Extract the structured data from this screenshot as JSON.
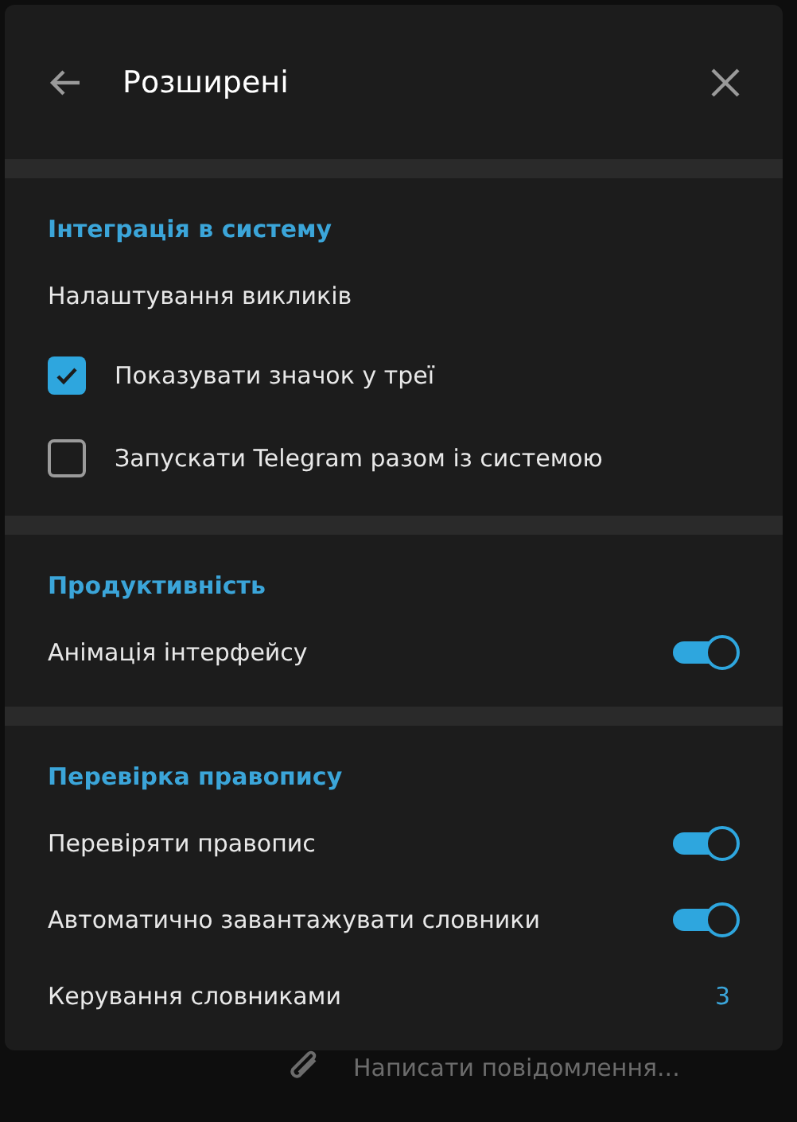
{
  "dialog": {
    "title": "Розширені",
    "sections": [
      {
        "title": "Інтеграція в систему",
        "items": [
          {
            "kind": "link",
            "label": "Налаштування викликів"
          },
          {
            "kind": "checkbox",
            "label": "Показувати значок у треї",
            "checked": true
          },
          {
            "kind": "checkbox",
            "label": "Запускати Telegram разом із системою",
            "checked": false
          }
        ]
      },
      {
        "title": "Продуктивність",
        "items": [
          {
            "kind": "toggle",
            "label": "Анімація інтерфейсу",
            "on": true
          }
        ]
      },
      {
        "title": "Перевірка правопису",
        "items": [
          {
            "kind": "toggle",
            "label": "Перевіряти правопис",
            "on": true
          },
          {
            "kind": "toggle",
            "label": "Автоматично завантажувати словники",
            "on": true
          },
          {
            "kind": "value",
            "label": "Керування словниками",
            "value": "3"
          }
        ]
      }
    ]
  },
  "composer": {
    "placeholder": "Написати повідомлення..."
  }
}
